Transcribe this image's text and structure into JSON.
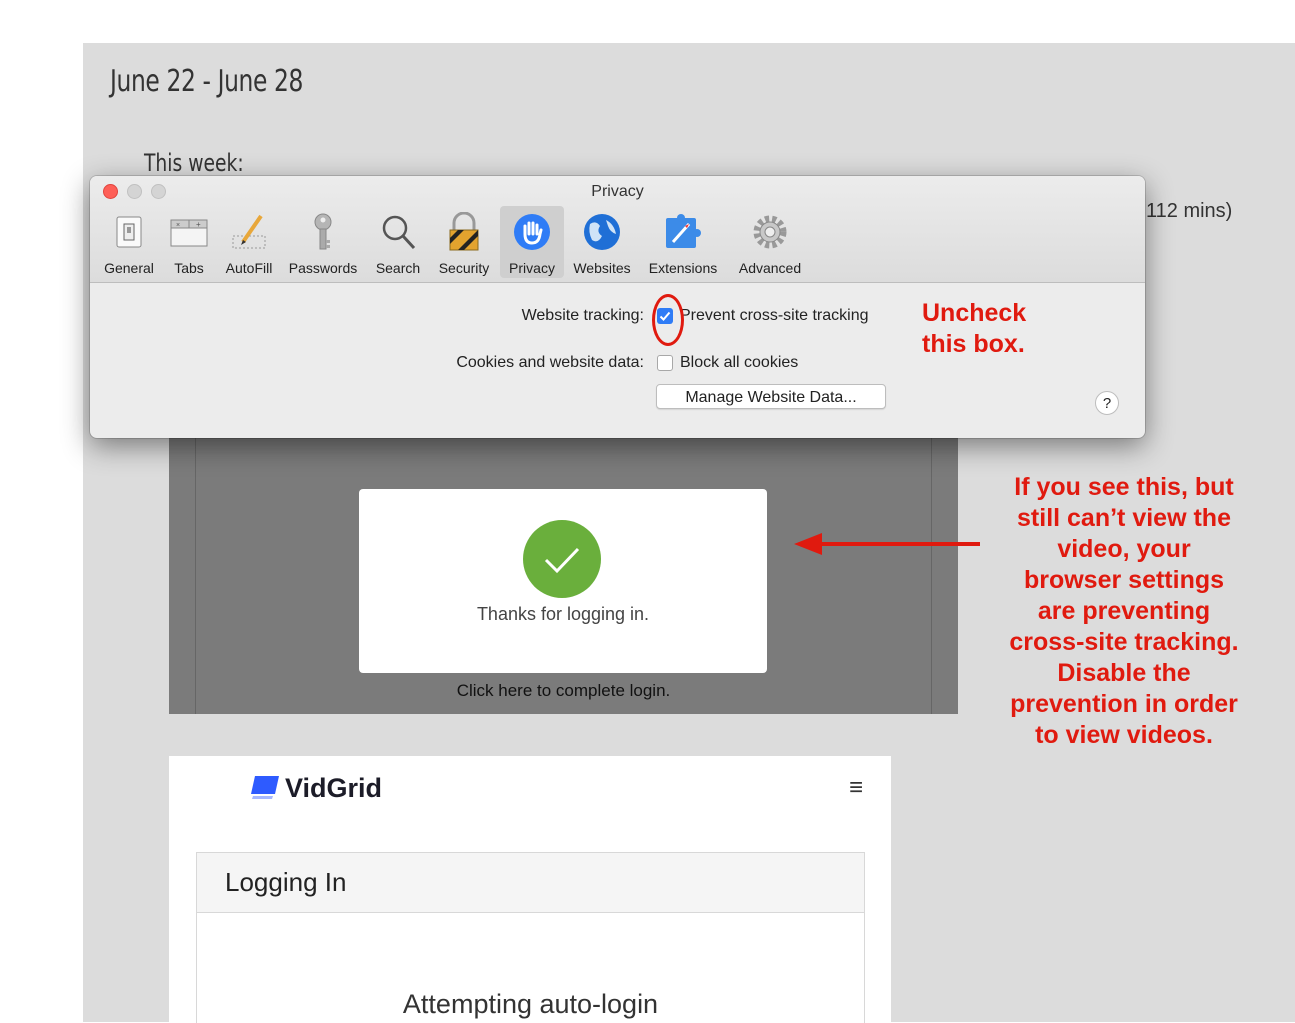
{
  "page": {
    "week_title": "June 22 - June 28",
    "this_week": "This week:",
    "mins_fragment": "112 mins)"
  },
  "privacy_dialog": {
    "title": "Privacy",
    "toolbar": [
      {
        "label": "General",
        "icon": "general-icon"
      },
      {
        "label": "Tabs",
        "icon": "tabs-icon"
      },
      {
        "label": "AutoFill",
        "icon": "autofill-icon"
      },
      {
        "label": "Passwords",
        "icon": "key-icon"
      },
      {
        "label": "Search",
        "icon": "search-icon"
      },
      {
        "label": "Security",
        "icon": "lock-icon"
      },
      {
        "label": "Privacy",
        "icon": "hand-icon",
        "active": true
      },
      {
        "label": "Websites",
        "icon": "globe-icon"
      },
      {
        "label": "Extensions",
        "icon": "puzzle-icon"
      },
      {
        "label": "Advanced",
        "icon": "gear-icon"
      }
    ],
    "website_tracking_label": "Website tracking:",
    "prevent_tracking_text": "Prevent cross-site tracking",
    "prevent_tracking_checked": true,
    "cookies_label": "Cookies and website data:",
    "block_cookies_text": "Block all cookies",
    "block_cookies_checked": false,
    "manage_button": "Manage Website Data...",
    "help_button": "?"
  },
  "annotations": {
    "uncheck_line1": "Uncheck",
    "uncheck_line2": "this box.",
    "note_lines": [
      "If you see this, but",
      "still can’t view the",
      "video, your",
      "browser settings",
      "are preventing",
      "cross-site tracking.",
      "Disable the",
      "prevention in order",
      "to view videos."
    ],
    "color": "#e01a0f"
  },
  "embed": {
    "thanks_text": "Thanks for logging in.",
    "click_here": "Click here to complete login."
  },
  "vidgrid": {
    "brand": "VidGrid",
    "menu_icon": "≡",
    "card_title": "Logging In",
    "status": "Attempting auto-login"
  },
  "colors": {
    "check_green": "#6aaf3c",
    "checkbox_blue": "#2f7cf6",
    "vidgrid_blue": "#2e5bff"
  }
}
